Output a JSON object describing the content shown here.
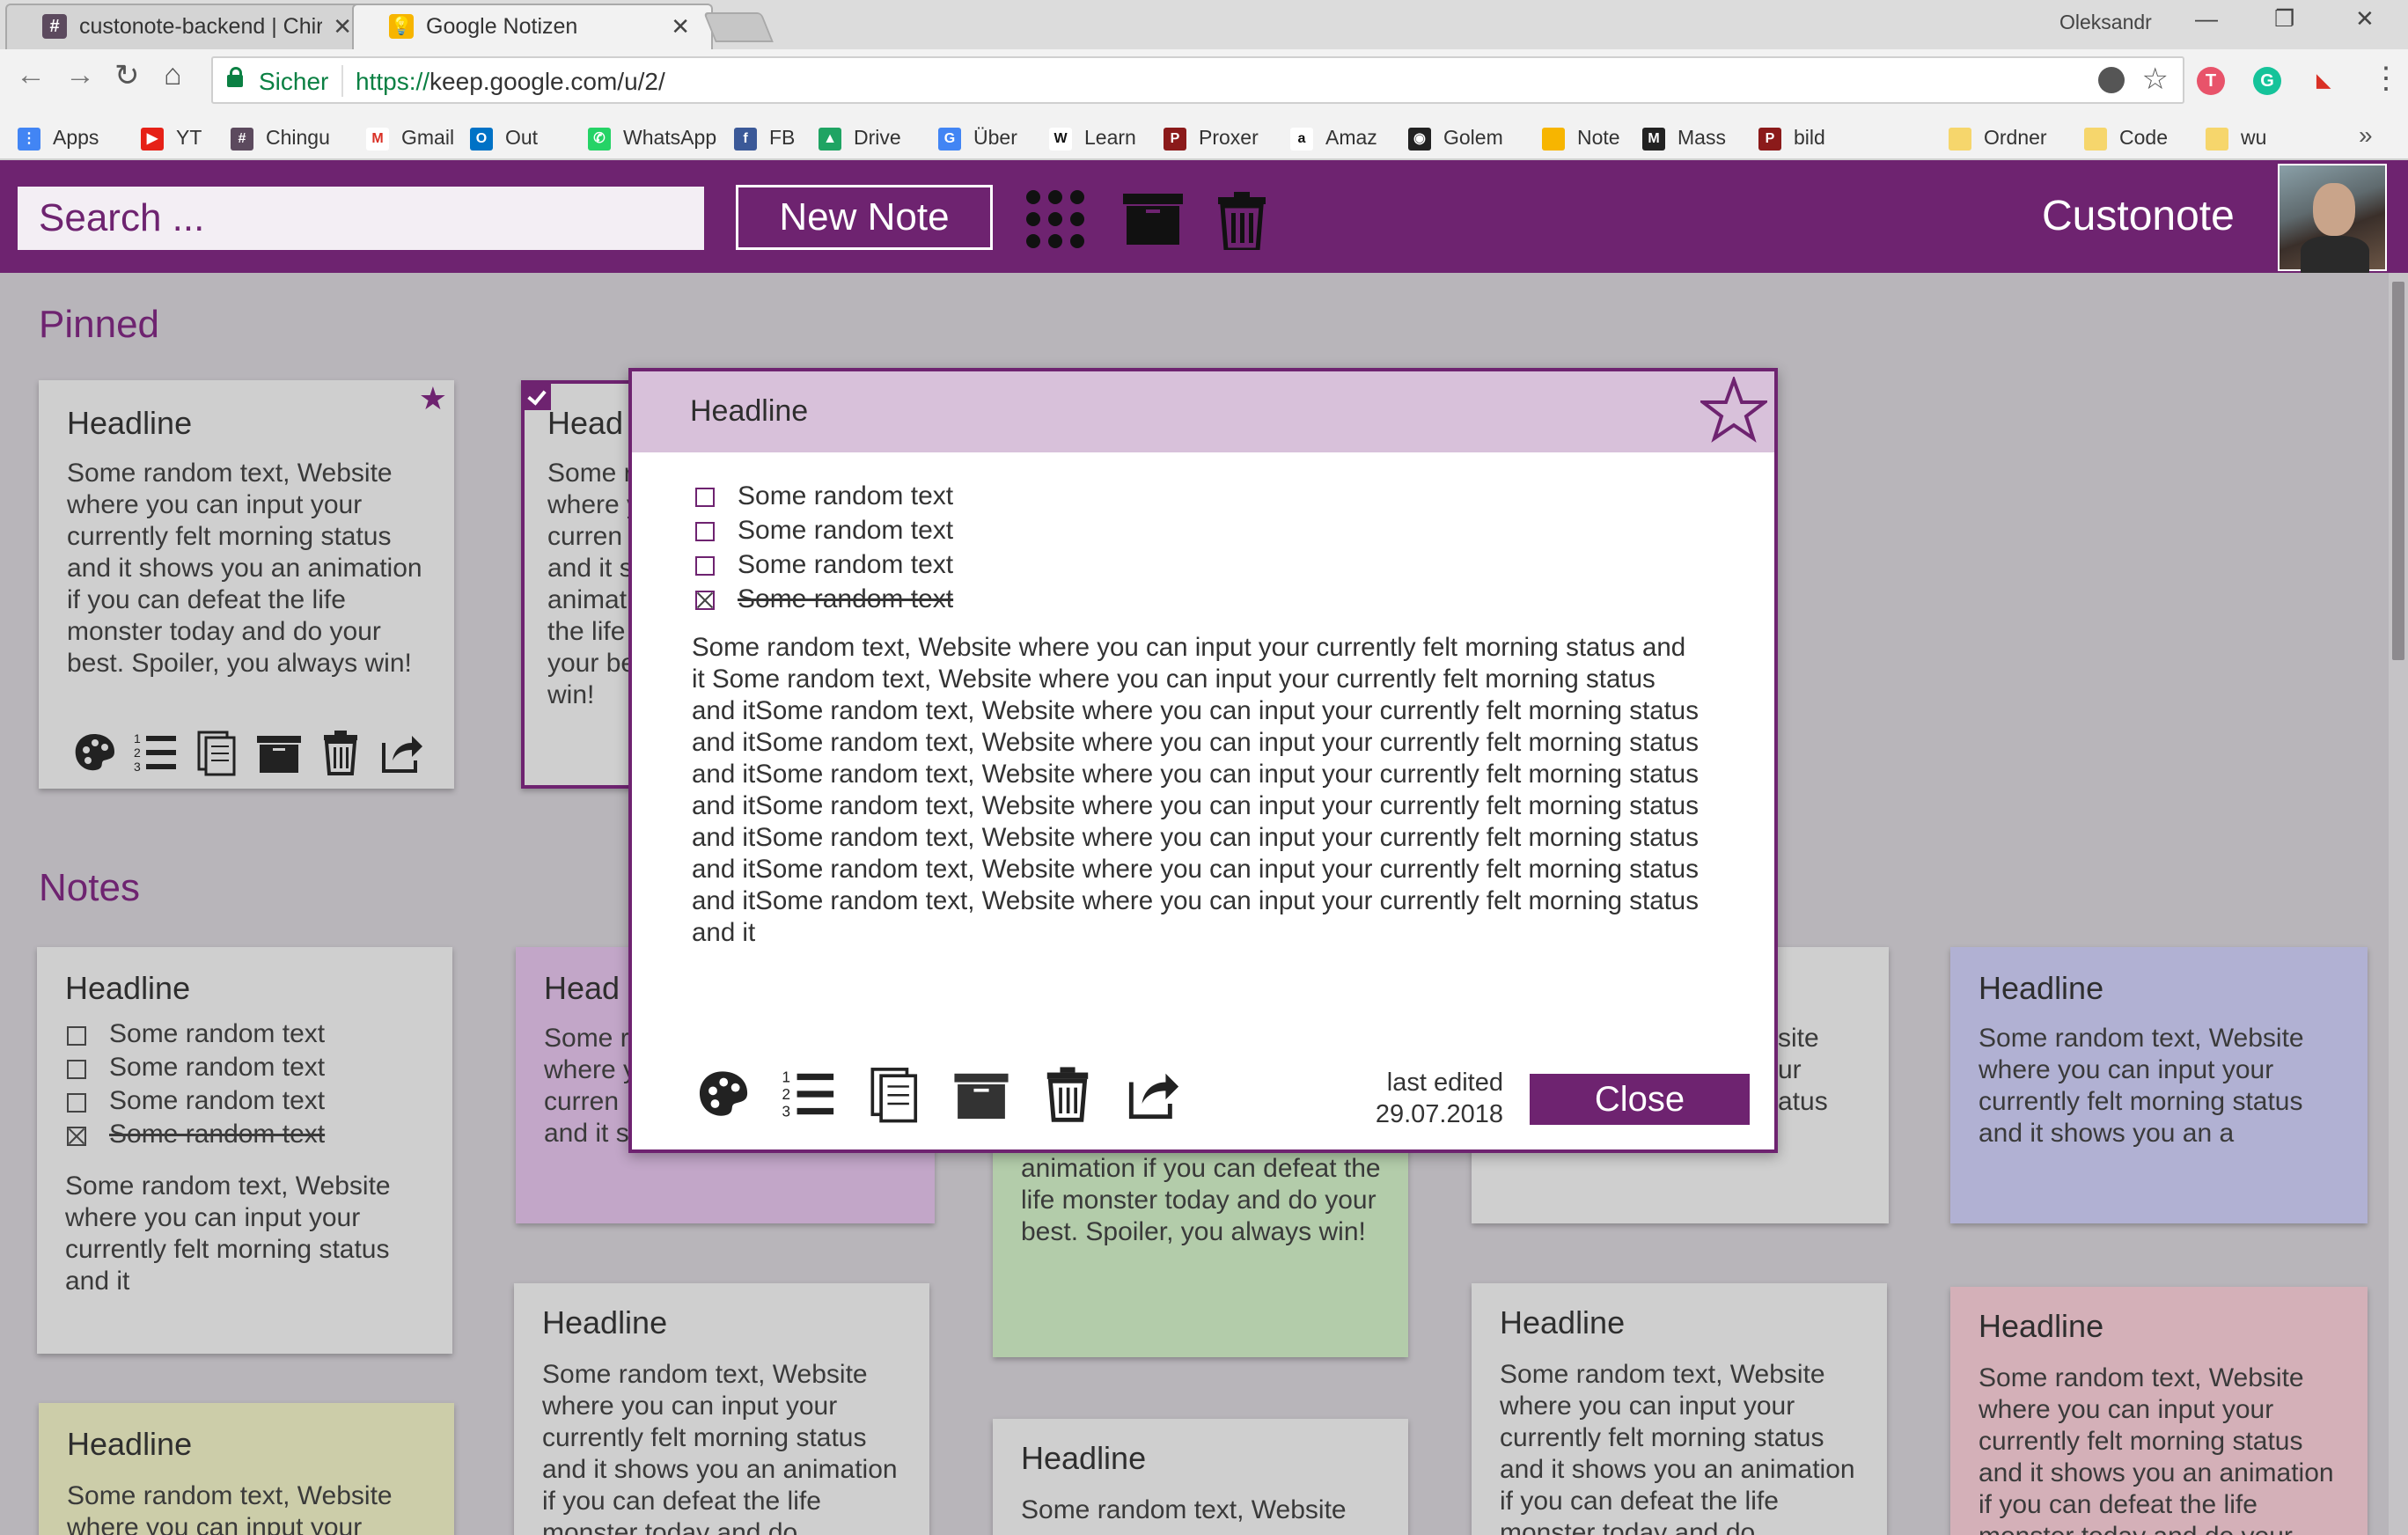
{
  "browser": {
    "tabs": [
      {
        "title": "custonote-backend | Chir",
        "favicon": "slack-hash-icon",
        "active": false
      },
      {
        "title": "Google Notizen",
        "favicon": "keep-bulb-icon",
        "active": true
      }
    ],
    "user": "Oleksandr",
    "secure_label": "Sicher",
    "url_scheme": "https://",
    "url_rest": "keep.google.com/u/2/",
    "bookmarks": [
      {
        "label": "Apps",
        "icon": "apps-grid-icon"
      },
      {
        "label": "YT",
        "icon": "youtube-icon"
      },
      {
        "label": "Chingu",
        "icon": "slack-hash-icon"
      },
      {
        "label": "Gmail",
        "icon": "gmail-icon"
      },
      {
        "label": "Out",
        "icon": "outlook-icon"
      },
      {
        "label": "WhatsApp",
        "icon": "whatsapp-icon"
      },
      {
        "label": "FB",
        "icon": "facebook-icon"
      },
      {
        "label": "Drive",
        "icon": "drive-icon"
      },
      {
        "label": "Über",
        "icon": "translate-icon"
      },
      {
        "label": "Learn",
        "icon": "w-icon"
      },
      {
        "label": "Proxer",
        "icon": "proxer-icon"
      },
      {
        "label": "Amaz",
        "icon": "amazon-icon"
      },
      {
        "label": "Golem",
        "icon": "golem-icon"
      },
      {
        "label": "Note",
        "icon": "keep-bulb-icon"
      },
      {
        "label": "Mass",
        "icon": "m-icon"
      },
      {
        "label": "bild",
        "icon": "proxer-icon"
      },
      {
        "label": "Ordner",
        "icon": "folder-icon"
      },
      {
        "label": "Code",
        "icon": "folder-icon"
      },
      {
        "label": "wu",
        "icon": "folder-icon"
      }
    ]
  },
  "header": {
    "search_placeholder": "Search ...",
    "new_note": "New Note",
    "brand": "Custonote"
  },
  "sections": {
    "pinned": "Pinned",
    "notes": "Notes"
  },
  "text": {
    "headline": "Headline",
    "item": "Some random text",
    "long": "Some random text, Website where you can input your currently felt morning status and it shows you an animation if you can defeat the life monster today and do your best. Spoiler, you always win!",
    "short": "Some random text, Website where you can input your currently felt morning status and it",
    "short2": "Some random text, Website where you can input your currently felt morning status and it shows you an a",
    "frag_head": "Head",
    "pinned2_lines": [
      "Some r",
      "where y",
      "curren",
      "and it s",
      "animat",
      "the life",
      "your be",
      "win!"
    ],
    "notes2_lines": [
      "Some r",
      "where y",
      "curren",
      "and it s"
    ],
    "green_tail": "animation if you can defeat the life monster today and do your best. Spoiler, you always win!",
    "right_frag": [
      "site",
      "ur",
      "atus"
    ],
    "bottom_yellow": "Some random text, Website where you can input your",
    "bottom_mid": "Some random text, Website",
    "bottom_cut": "Some random text, Website where you can input your currently felt morning status and it shows you an animation if you can defeat the life monster today and do"
  },
  "modal": {
    "headline": "Headline",
    "items": [
      {
        "text": "Some random text",
        "checked": false
      },
      {
        "text": "Some random text",
        "checked": false
      },
      {
        "text": "Some random text",
        "checked": false
      },
      {
        "text": "Some random text",
        "checked": true
      }
    ],
    "body": "Some random text, Website where you can input your currently felt morning status and it Some random text, Website where you can input your currently felt morning status and itSome random text, Website where you can input your currently felt morning status and itSome random text, Website where you can input your currently felt morning status and itSome random text, Website where you can input your currently felt morning status and itSome random text, Website where you can input your currently felt morning status and itSome random text, Website where you can input your currently felt morning status and itSome random text, Website where you can input your currently felt morning status and itSome random text, Website where you can input your currently felt morning status and it",
    "last_edited_label": "last edited",
    "last_edited_date": "29.07.2018",
    "close": "Close"
  },
  "colors": {
    "brand": "#6e2370",
    "card_grey": "#cfcfcf",
    "card_purple": "#c2a6c8",
    "card_green": "#b3ccaa",
    "card_blue": "#b1b1d3",
    "card_pink": "#d4b0b8",
    "card_yellow": "#cccda9"
  }
}
